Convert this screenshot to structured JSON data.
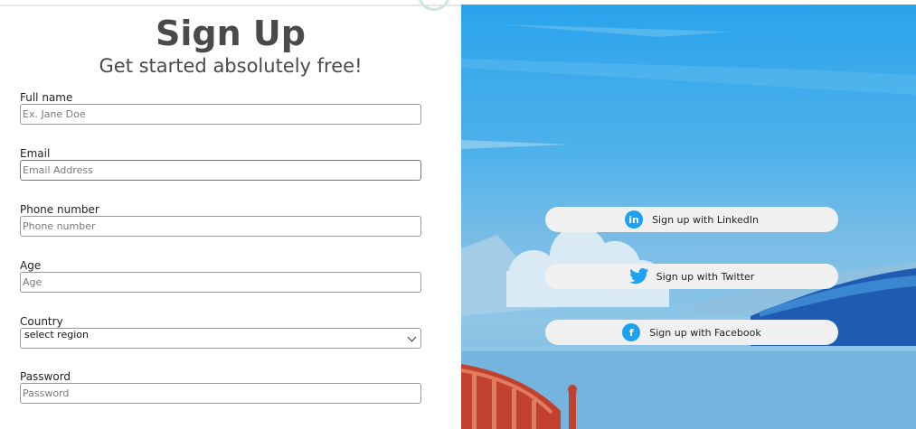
{
  "header": {
    "title": "Sign Up",
    "subtitle": "Get started absolutely free!"
  },
  "form": {
    "fullname": {
      "label": "Full name",
      "placeholder": "Ex. Jane Doe"
    },
    "email": {
      "label": "Email",
      "placeholder": "Email Address"
    },
    "phone": {
      "label": "Phone number",
      "placeholder": "Phone number"
    },
    "age": {
      "label": "Age",
      "placeholder": "Age"
    },
    "country": {
      "label": "Country",
      "selected": "select region"
    },
    "password": {
      "label": "Password",
      "placeholder": "Password"
    }
  },
  "social": {
    "linkedin": {
      "label": "Sign up with LinkedIn",
      "icon": "linkedin-icon"
    },
    "twitter": {
      "label": "Sign up with Twitter",
      "icon": "twitter-icon"
    },
    "facebook": {
      "label": "Sign up with Facebook",
      "icon": "facebook-icon"
    }
  },
  "colors": {
    "title": "#4a4a4a",
    "social_button_bg": "#f0f0f0",
    "icon_blue": "#1da1f2",
    "sky_top": "#2aa3ec",
    "sea": "#74b4de",
    "bridge": "#c2412e"
  }
}
